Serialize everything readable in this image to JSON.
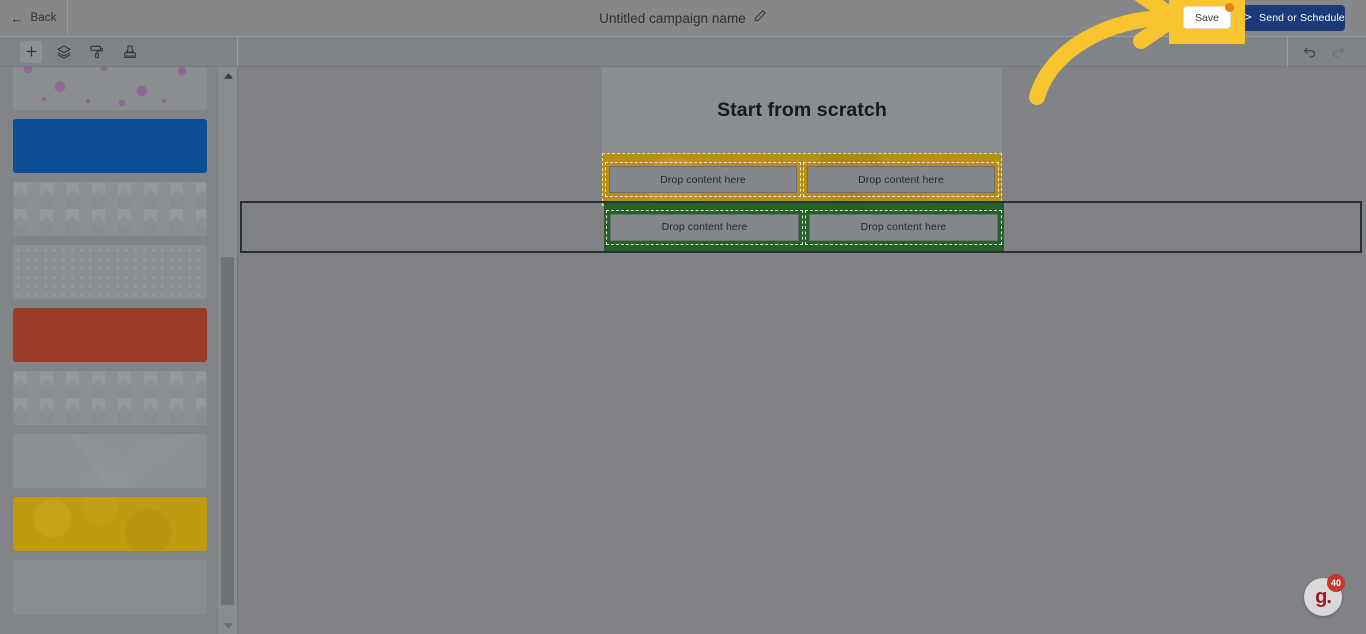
{
  "header": {
    "back_label": "Back",
    "back_icon": "arrow-left-icon",
    "campaign_title": "Untitled campaign name",
    "edit_icon": "pencil-icon",
    "save_label": "Save",
    "save_badge_color": "#E8820C",
    "send_label": "Send or Schedule",
    "send_icon": "send-plane-icon",
    "send_button_color": "#1B3A7A",
    "highlight_color": "#F8C430"
  },
  "toolbar": {
    "tools": [
      {
        "name": "add-content-icon",
        "title": "Add"
      },
      {
        "name": "layers-icon",
        "title": "Blocks"
      },
      {
        "name": "paint-roller-icon",
        "title": "Styles"
      },
      {
        "name": "stamp-icon",
        "title": "Body"
      }
    ],
    "undo_icon": "undo-icon",
    "redo_icon": "redo-icon"
  },
  "left_panel": {
    "thumbnails": [
      {
        "kind": "pattern-gears",
        "label": "gear pattern background"
      },
      {
        "kind": "solid-blue",
        "label": "solid blue background",
        "color": "#0B4D96"
      },
      {
        "kind": "pattern-triangle",
        "label": "triangle pattern background"
      },
      {
        "kind": "pattern-dots",
        "label": "dotted pattern background"
      },
      {
        "kind": "solid-red",
        "label": "solid red background",
        "color": "#9B3B2C"
      },
      {
        "kind": "pattern-triangle",
        "label": "triangle pattern background"
      },
      {
        "kind": "pattern-polygon",
        "label": "polygon pattern background"
      },
      {
        "kind": "solid-gold",
        "label": "gold texture background",
        "color": "#BF9B10"
      },
      {
        "kind": "plain",
        "label": "plain background"
      }
    ],
    "scrollbar": {
      "up_icon": "scroll-up-icon",
      "down_icon": "scroll-down-icon"
    }
  },
  "canvas": {
    "heading": "Start from scratch",
    "rows": [
      {
        "name": "gold-row",
        "background_color": "#B5910F",
        "cells": [
          {
            "label": "Drop content here"
          },
          {
            "label": "Drop content here"
          }
        ]
      },
      {
        "name": "green-row",
        "background_color": "#256028",
        "selected": true,
        "cells": [
          {
            "label": "Drop content here"
          },
          {
            "label": "Drop content here"
          }
        ]
      }
    ]
  },
  "help_widget": {
    "logo_text": "g.",
    "badge_count": "40",
    "badge_color": "#C0392B"
  }
}
